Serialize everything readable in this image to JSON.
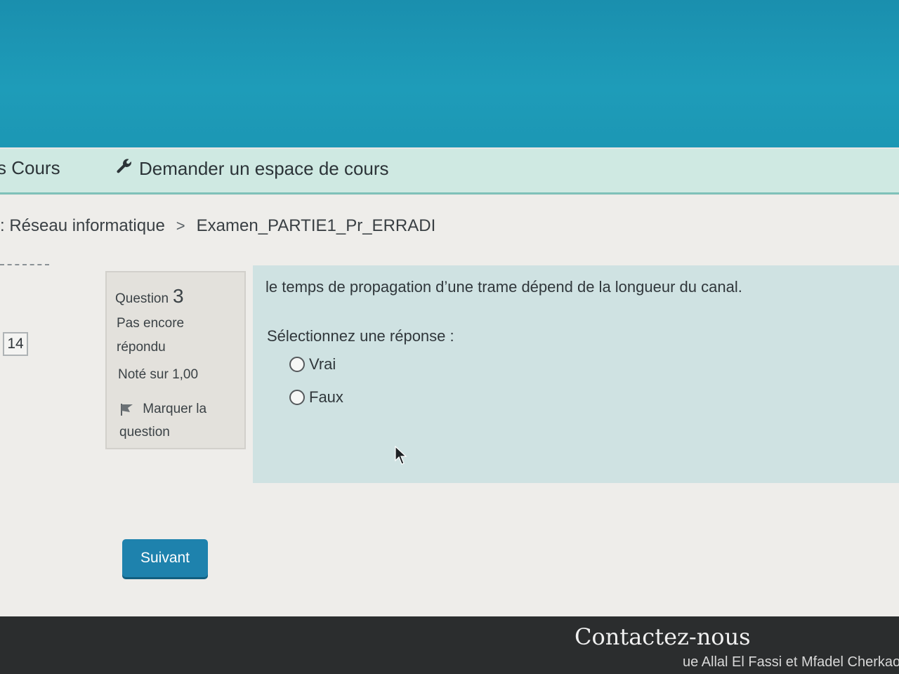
{
  "nav": {
    "cours_label": "s Cours",
    "request_label": "Demander un espace de cours"
  },
  "breadcrumb": {
    "course": ": Réseau informatique",
    "separator": ">",
    "exam": "Examen_PARTIE1_Pr_ERRADI"
  },
  "quiz_nav": {
    "current_box": "14"
  },
  "question_info": {
    "label": "Question",
    "number": "3",
    "state": "Pas encore répondu",
    "grade": "Noté sur 1,00",
    "flag_label": "Marquer la question"
  },
  "question": {
    "text": "le temps de propagation d’une trame dépend de la longueur du canal.",
    "prompt": "Sélectionnez une réponse :",
    "options": [
      "Vrai",
      "Faux"
    ]
  },
  "buttons": {
    "next": "Suivant"
  },
  "footer": {
    "contact_title": "Contactez-nous",
    "address_fragment": "ue Allal El Fassi et Mfadel Cherkaou"
  }
}
